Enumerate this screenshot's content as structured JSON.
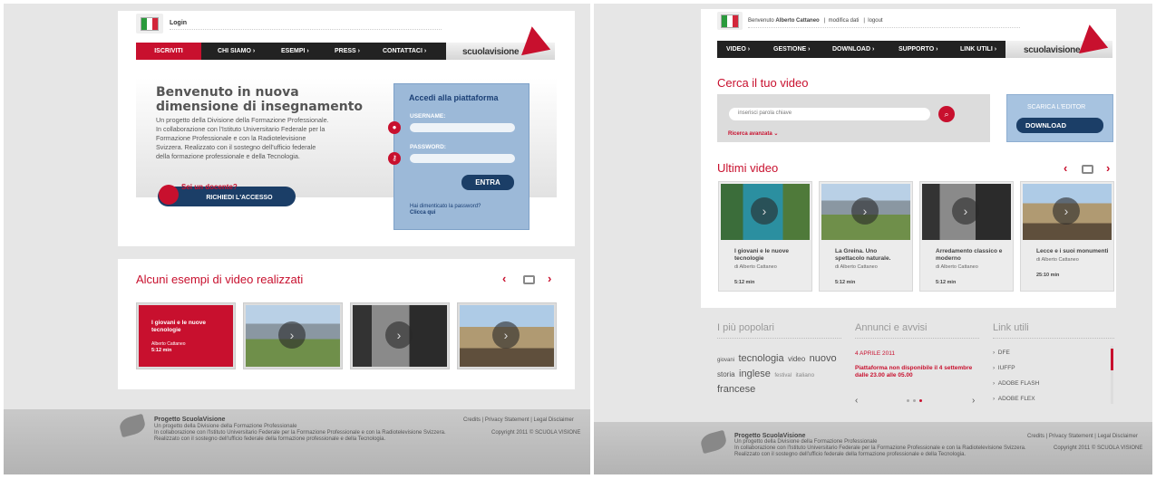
{
  "left": {
    "topbar": {
      "login": "Login"
    },
    "nav": {
      "items": [
        "ISCRIVITI",
        "CHI SIAMO ›",
        "ESEMPI ›",
        "PRESS ›",
        "CONTATTACI ›"
      ]
    },
    "logo": "scuolavisione",
    "hero": {
      "title1": "Benvenuto in nuova",
      "title2": "dimensione di insegnamento",
      "desc": [
        "Un progetto della Divisione della Formazione Professionale.",
        "In collaborazione con l'Istituto Universitario Federale per la",
        "Formazione Professionale e con la Radiotelevisione",
        "Svizzera. Realizzato con il sostegno dell'ufficio federale",
        "della formazione professionale e della Tecnologia."
      ],
      "docente": "Sei un docente?",
      "access": "RICHIEDI L'ACCESSO"
    },
    "login": {
      "title": "Accedi alla piattaforma",
      "username": "USERNAME:",
      "password": "PASSWORD:",
      "enter": "ENTRA",
      "forgot": "Hai dimenticato la password?",
      "click": "Clicca qui"
    },
    "examples": {
      "title": "Alcuni esempi di video realizzati",
      "first": {
        "title1": "I giovani e le nuove",
        "title2": "tecnologie",
        "author": "Alberto Cattaneo",
        "duration": "5:12 min"
      }
    },
    "footer": {
      "title": "Progetto ScuolaVisione",
      "lines": [
        "Un progetto della Divisione della Formazione Professionale",
        "In collaborazione con l'Istituto Universitario Federale per la Formazione Professionale e con la Radiotelevisione Svizzera.",
        "Realizzato con il sostegno dell'ufficio federale della formazione professionale e della Tecnologia."
      ],
      "links": "Credits  |  Privacy Statement  |  Legal Disclaimer",
      "copy": "Copyright 2011 © SCUOLA VISIONE"
    }
  },
  "right": {
    "topbar": {
      "welcome": "Benvenuto",
      "user": "Alberto Cattaneo",
      "sep": "|",
      "edit": "modifica dati",
      "logout": "logout"
    },
    "nav": {
      "items": [
        "VIDEO ›",
        "GESTIONE ›",
        "DOWNLOAD ›",
        "SUPPORTO ›",
        "LINK UTILI ›"
      ]
    },
    "logo": "scuolavisione",
    "search": {
      "title": "Cerca il tuo video",
      "placeholder": "inserisci parola chiave",
      "advanced": "Ricerca avanzata"
    },
    "editor": {
      "title": "SCARICA L'EDITOR",
      "button": "DOWNLOAD"
    },
    "latest": {
      "title": "Ultimi video",
      "cards": [
        {
          "t1": "I giovani e le nuove",
          "t2": "tecnologie",
          "author": "di Alberto Cattaneo",
          "dur": "5:12 min"
        },
        {
          "t1": "La Greina. Uno",
          "t2": "spettacolo naturale.",
          "author": "di Alberto Cattaneo",
          "dur": "5:12 min"
        },
        {
          "t1": "Arredamento classico e",
          "t2": "moderno",
          "author": "di Alberto Cattaneo",
          "dur": "5:12 min"
        },
        {
          "t1": "Lecce e i suoi monumenti",
          "t2": "",
          "author": "di Alberto Cattaneo",
          "dur": "25:10 min"
        }
      ]
    },
    "popular": {
      "title": "I più popolari",
      "tags": [
        [
          "giovani",
          "tecnologia",
          "video",
          "nuovo"
        ],
        [
          "storia",
          "inglese",
          "festival",
          "italiano"
        ],
        [
          "francese"
        ]
      ]
    },
    "news": {
      "title": "Annunci e avvisi",
      "date": "4 APRILE 2011",
      "text1": "Piattaforma non disponibile il 4 settembre",
      "text2": "dalle 23.00 alle 05.00"
    },
    "links": {
      "title": "Link utili",
      "items": [
        "DFE",
        "IUFFP",
        "ADOBE FLASH",
        "ADOBE FLEX"
      ]
    },
    "footer": {
      "title": "Progetto ScuolaVisione",
      "lines": [
        "Un progetto della Divisione della Formazione Professionale",
        "In collaborazione con l'Istituto Universitario Federale per la Formazione Professionale e con la Radiotelevisione Svizzera.",
        "Realizzato con il sostegno dell'ufficio federale della formazione professionale e della Tecnologia."
      ],
      "links": "Credits  |  Privacy Statement  |  Legal Disclaimer",
      "copy": "Copyright 2011 © SCUOLA VISIONE"
    }
  },
  "icons": {
    "chev_left": "‹",
    "chev_right": "›",
    "play": "›",
    "user": "user-icon",
    "key": "key-icon",
    "search": "search-icon"
  }
}
